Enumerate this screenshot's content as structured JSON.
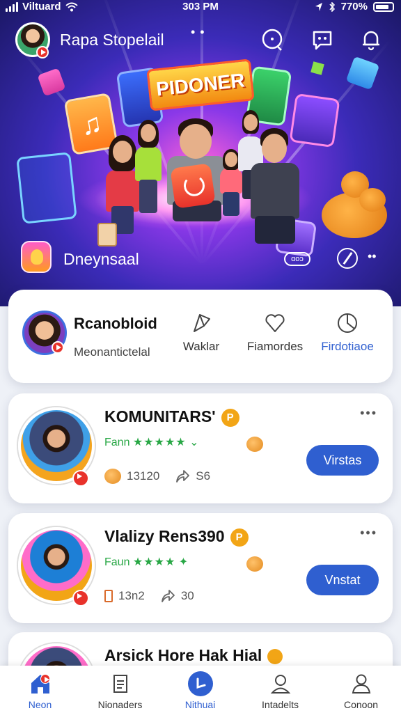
{
  "status_bar": {
    "carrier": "Viltuard",
    "time": "303 PM",
    "battery": "770%"
  },
  "header": {
    "title": "Rapa Stopelail"
  },
  "hero": {
    "banner_text": "PIDONER",
    "label": "Dneynsaal",
    "cloud_text": "ɑoɔ"
  },
  "profile": {
    "name": "Rcanobloid",
    "subtitle": "Meonantictelal",
    "actions": [
      {
        "label": "Waklar",
        "icon": "pin-icon"
      },
      {
        "label": "Fiamordes",
        "icon": "heart-icon"
      },
      {
        "label": "Firdotiaoe",
        "icon": "pie-icon"
      }
    ]
  },
  "items": [
    {
      "title": "KOMUNITARS'",
      "coin": "P",
      "rating_label": "Fann",
      "stars": "★★★★★",
      "likes": "13120",
      "shares": "S6",
      "button": "Virstas"
    },
    {
      "title": "Vlalizy Rens390",
      "coin": "P",
      "rating_label": "Faun",
      "stars": "★★★★",
      "likes": "13n2",
      "shares": "30",
      "button": "Vnstat"
    },
    {
      "title": "Arsick Hore Hak Hial",
      "coin": ""
    }
  ],
  "nav": [
    {
      "label": "Neon",
      "icon": "home-icon"
    },
    {
      "label": "Nionaders",
      "icon": "document-icon"
    },
    {
      "label": "Nithuai",
      "icon": "play-icon"
    },
    {
      "label": "Intadelts",
      "icon": "person-icon"
    },
    {
      "label": "Conoon",
      "icon": "profile-icon"
    }
  ],
  "colors": {
    "accent": "#2f5fd0",
    "live": "#e8322b",
    "coin": "#f2a516",
    "rating": "#28a745"
  }
}
